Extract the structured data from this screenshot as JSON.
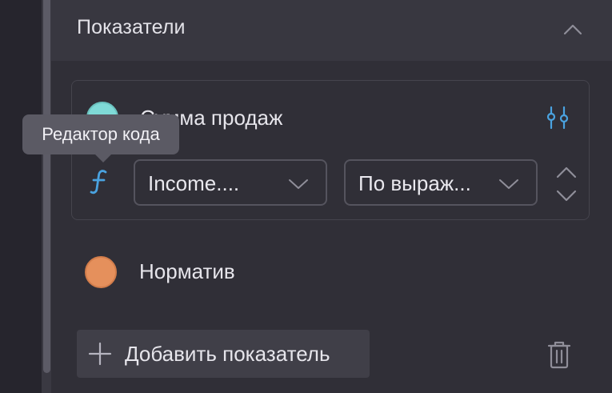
{
  "panel": {
    "title": "Показатели"
  },
  "metrics": [
    {
      "label": "Сумма продаж",
      "color": "#7fdad7",
      "field_select": "Income....",
      "aggregation_select": "По выраж..."
    },
    {
      "label": "Норматив",
      "color": "#e5905c"
    }
  ],
  "add_metric_label": "Добавить показатель",
  "tooltip": {
    "text": "Редактор кода"
  },
  "icons": {
    "collapse": "chevron-up-icon",
    "settings": "sliders-icon",
    "function": "function-icon",
    "sort_up": "chevron-up-icon",
    "sort_down": "chevron-down-icon",
    "add": "plus-icon",
    "delete": "trash-icon"
  },
  "colors": {
    "accent": "#4aa3e0",
    "background": "#302f37",
    "header": "#383740"
  }
}
